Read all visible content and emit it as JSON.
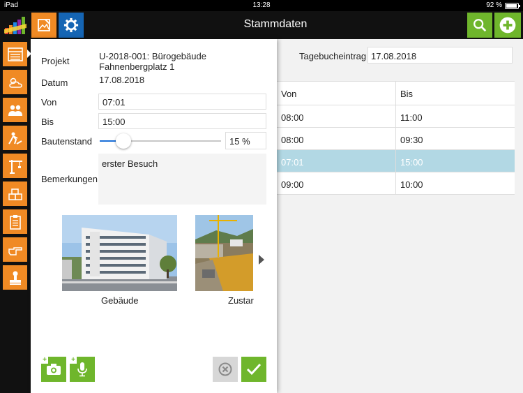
{
  "status_bar": {
    "device": "iPad",
    "time": "13:28",
    "battery": "92 %"
  },
  "header": {
    "title": "Stammdaten"
  },
  "icons": {
    "top_left": [
      "image-edit-icon",
      "gear-icon"
    ],
    "top_right": [
      "search-icon",
      "add-icon"
    ],
    "sidebar": [
      "list-icon",
      "weather-icon",
      "people-icon",
      "worker-icon",
      "crane-icon",
      "materials-icon",
      "clipboard-icon",
      "pointing-hand-icon",
      "stamp-icon"
    ]
  },
  "background_view": {
    "entry_label": "Tagebucheintrag",
    "entry_value": "17.08.2018",
    "columns": [
      "Von",
      "Bis"
    ],
    "rows": [
      [
        "08:00",
        "11:00"
      ],
      [
        "08:00",
        "09:30"
      ],
      [
        "07:01",
        "15:00"
      ],
      [
        "09:00",
        "10:00"
      ]
    ],
    "selected_row": 2
  },
  "form": {
    "projekt_label": "Projekt",
    "projekt_value_line1": "U-2018-001: Bürogebäude",
    "projekt_value_line2": "Fahnenbergplatz 1",
    "datum_label": "Datum",
    "datum_value": "17.08.2018",
    "von_label": "Von",
    "von_value": "07:01",
    "bis_label": "Bis",
    "bis_value": "15:00",
    "bautenstand_label": "Bautenstand",
    "bautenstand_value": "15 %",
    "bautenstand_fraction": 0.15,
    "bemerkungen_label": "Bemerkungen",
    "bemerkungen_value": "erster Besuch"
  },
  "photos": [
    {
      "caption": "Gebäude"
    },
    {
      "caption": "Zustar"
    }
  ],
  "colors": {
    "orange": "#f08a24",
    "blue": "#1565b4",
    "green": "#6fb62c",
    "selected_row": "#b2d8e4",
    "slider": "#1a6fd8"
  }
}
